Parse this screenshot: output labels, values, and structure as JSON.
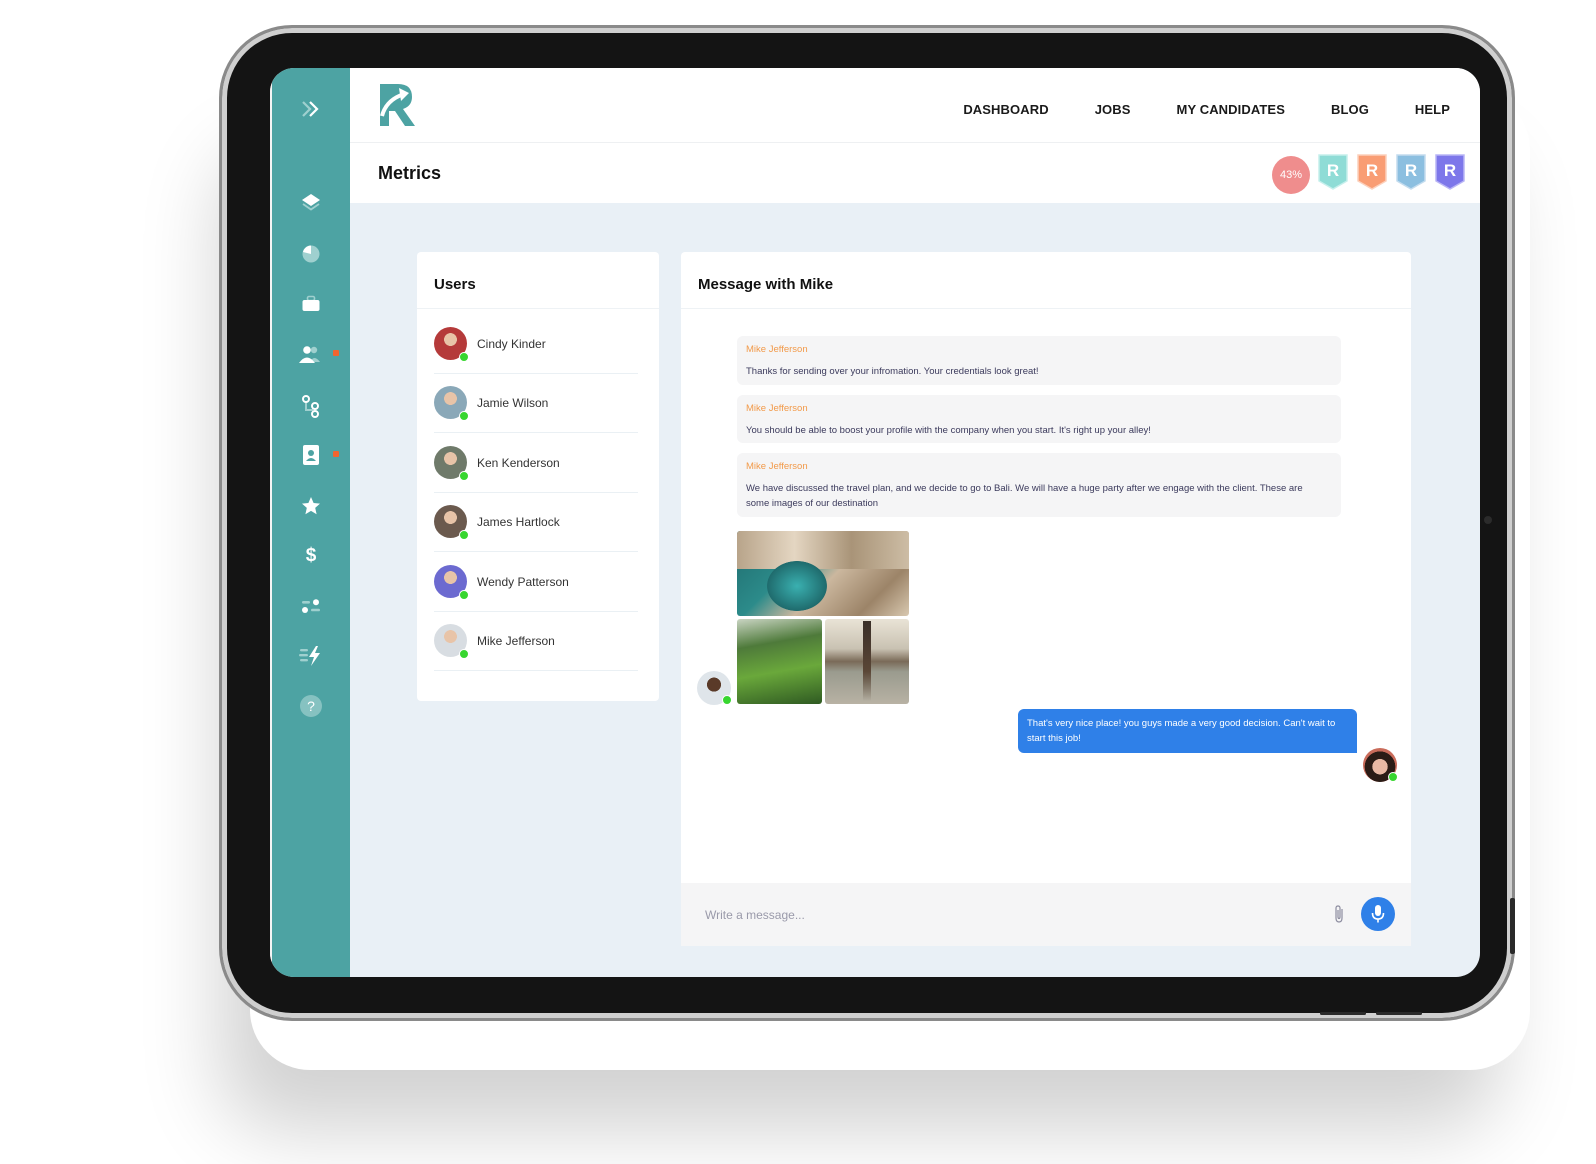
{
  "sidebar": {
    "expand_icon": "double-chevron-right-icon",
    "items": [
      {
        "icon": "layers-icon",
        "notify": false
      },
      {
        "icon": "pie-chart-icon",
        "notify": false
      },
      {
        "icon": "briefcase-icon",
        "notify": false
      },
      {
        "icon": "users-icon",
        "notify": true
      },
      {
        "icon": "workflow-icon",
        "notify": false
      },
      {
        "icon": "contact-card-icon",
        "notify": true
      },
      {
        "icon": "star-icon",
        "notify": false
      },
      {
        "icon": "dollar-icon",
        "notify": false
      },
      {
        "icon": "filters-icon",
        "notify": false
      },
      {
        "icon": "lightning-icon",
        "notify": false
      },
      {
        "icon": "help-icon",
        "notify": false
      }
    ]
  },
  "header": {
    "logo": "R",
    "nav": [
      "DASHBOARD",
      "JOBS",
      "MY CANDIDATES",
      "BLOG",
      "HELP"
    ]
  },
  "subheader": {
    "title": "Metrics",
    "progress_label": "43%",
    "progress_value": 43,
    "badges": [
      {
        "letter": "R",
        "color": "#8fdcd6"
      },
      {
        "letter": "R",
        "color": "#f99d74"
      },
      {
        "letter": "R",
        "color": "#8cbfe0"
      },
      {
        "letter": "R",
        "color": "#7d77ea"
      }
    ]
  },
  "users_panel": {
    "title": "Users",
    "users": [
      {
        "name": "Cindy Kinder",
        "online": true,
        "avatar_color": "#b53a3a"
      },
      {
        "name": "Jamie Wilson",
        "online": true,
        "avatar_color": "#8aa8b8"
      },
      {
        "name": "Ken Kenderson",
        "online": true,
        "avatar_color": "#6f7a6a"
      },
      {
        "name": "James Hartlock",
        "online": true,
        "avatar_color": "#6b5a4e"
      },
      {
        "name": "Wendy Patterson",
        "online": true,
        "avatar_color": "#6c6ad0"
      },
      {
        "name": "Mike Jefferson",
        "online": true,
        "avatar_color": "#d8dde2"
      }
    ]
  },
  "chat": {
    "title": "Message with Mike",
    "messages": [
      {
        "author": "Mike Jefferson",
        "text": "Thanks for sending over your infromation. Your credentials look great!"
      },
      {
        "author": "Mike Jefferson",
        "text": "You should be able to boost your profile with the company when you start. It's right up your alley!"
      },
      {
        "author": "Mike Jefferson",
        "text": "We have discussed the travel plan, and we decide to go to Bali. We will have a huge party after we engage with the client. These are some images of our destination"
      }
    ],
    "images": [
      "bali-beach-cliff-photo",
      "rice-terrace-photo",
      "water-temple-photo"
    ],
    "reply": "That's very nice place! you guys made a very good decision. Can't wait to start this job!",
    "composer": {
      "placeholder": "Write a message...",
      "value": "",
      "attach_icon": "paperclip-icon",
      "mic_icon": "microphone-icon"
    }
  },
  "colors": {
    "sidebar": "#4da3a3",
    "accent_blue": "#2f80e8",
    "author_orange": "#f29a4a",
    "online_green": "#37d62f",
    "notify_orange": "#f0652f"
  }
}
